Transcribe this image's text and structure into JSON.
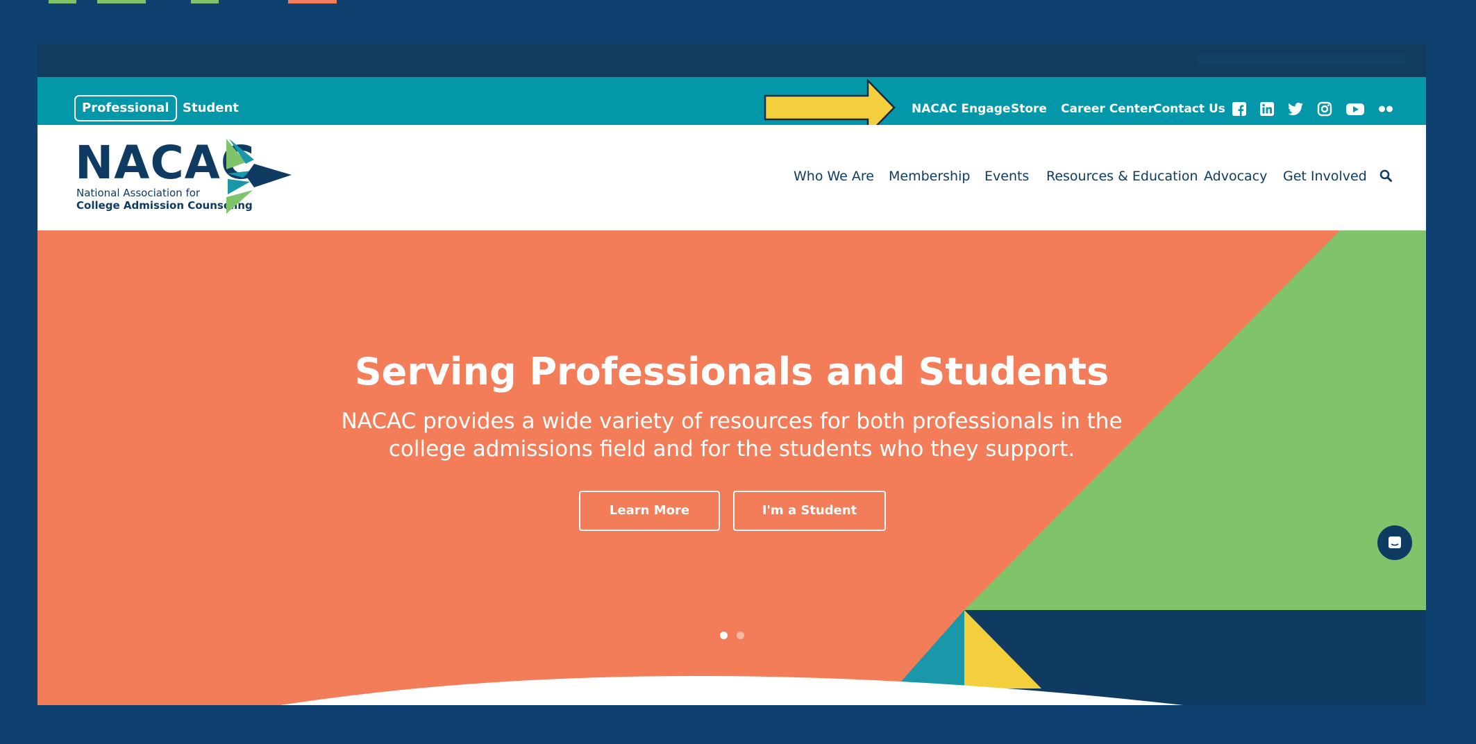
{
  "colors": {
    "frame": "#0e4170",
    "utility_bar": "#0496a9",
    "navy": "#0f3b62",
    "coral": "#f47d59",
    "green": "#7fc36b",
    "teal": "#1a97a8",
    "yellow": "#f3cf3d"
  },
  "utility": {
    "audience_professional": "Professional",
    "audience_student": "Student",
    "links": [
      "NACAC Engage",
      "Store",
      "Career Center",
      "Contact Us"
    ],
    "social_icons": [
      "facebook-icon",
      "linkedin-icon",
      "twitter-icon",
      "instagram-icon",
      "youtube-icon",
      "flickr-icon"
    ]
  },
  "header": {
    "logo_word": "NACAC",
    "logo_line1": "National Association for",
    "logo_line2": "College Admission Counseling",
    "nav": [
      "Who We Are",
      "Membership",
      "Events",
      "Resources & Education",
      "Advocacy",
      "Get Involved"
    ],
    "search_icon": "search-icon"
  },
  "hero": {
    "title": "Serving Professionals and Students",
    "text": "NACAC provides a wide variety of resources for both professionals in the college admissions field and for the students who they support.",
    "learn_more": "Learn More",
    "student_button": "I'm a Student",
    "carousel_slides": 2,
    "carousel_active": 1
  }
}
